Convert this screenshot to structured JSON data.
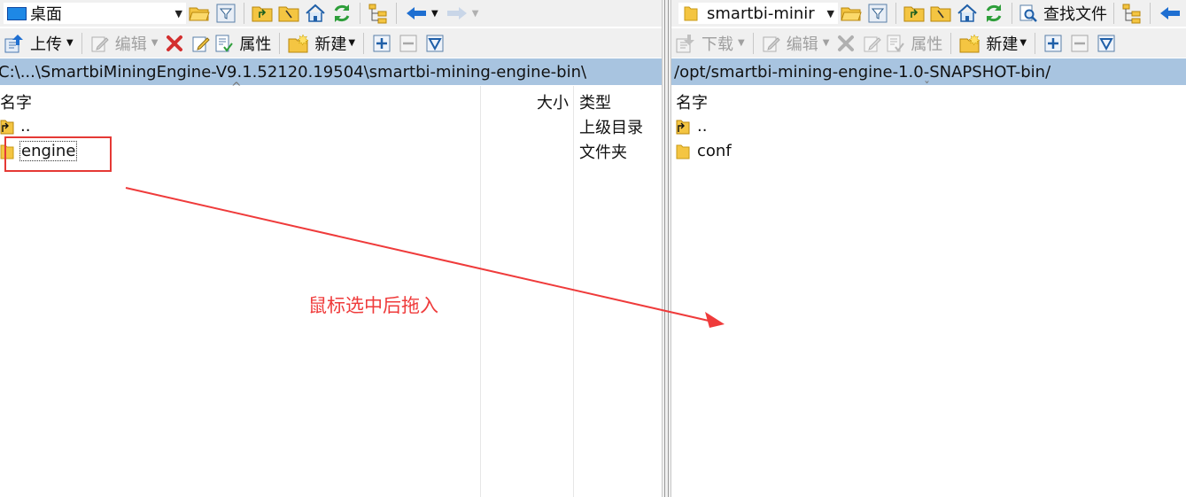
{
  "left": {
    "location": "桌面",
    "toolbar": {
      "upload": "上传",
      "edit": "编辑",
      "properties": "属性",
      "new": "新建"
    },
    "path": "C:\\...\\SmartbiMiningEngine-V9.1.52120.19504\\smartbi-mining-engine-bin\\",
    "columns": {
      "name": "名字",
      "size": "大小",
      "type": "类型"
    },
    "files": [
      {
        "name": "..",
        "type": "上级目录"
      },
      {
        "name": "engine",
        "type": "文件夹"
      }
    ]
  },
  "right": {
    "location": "smartbi-minir",
    "find_files": "查找文件",
    "toolbar": {
      "download": "下载",
      "edit": "编辑",
      "properties": "属性",
      "new": "新建"
    },
    "path": "/opt/smartbi-mining-engine-1.0-SNAPSHOT-bin/",
    "columns": {
      "name": "名字"
    },
    "files": [
      {
        "name": ".."
      },
      {
        "name": "conf"
      }
    ]
  },
  "annotation": {
    "text": "鼠标选中后拖入",
    "color": "#ef3b3b"
  },
  "colors": {
    "path_bar": "#a8c4e0",
    "folder": "#f4c542",
    "highlight": "#e53935"
  },
  "icons": [
    "desktop-icon",
    "folder-icon",
    "filter-icon",
    "parent-dir-icon",
    "root-dir-icon",
    "home-icon",
    "refresh-icon",
    "tree-icon",
    "back-arrow-icon",
    "forward-arrow-icon",
    "upload-icon",
    "download-icon",
    "edit-icon",
    "delete-icon",
    "rename-icon",
    "properties-icon",
    "new-folder-icon",
    "plus-icon",
    "minus-icon",
    "select-icon",
    "find-icon",
    "up-folder-icon"
  ]
}
